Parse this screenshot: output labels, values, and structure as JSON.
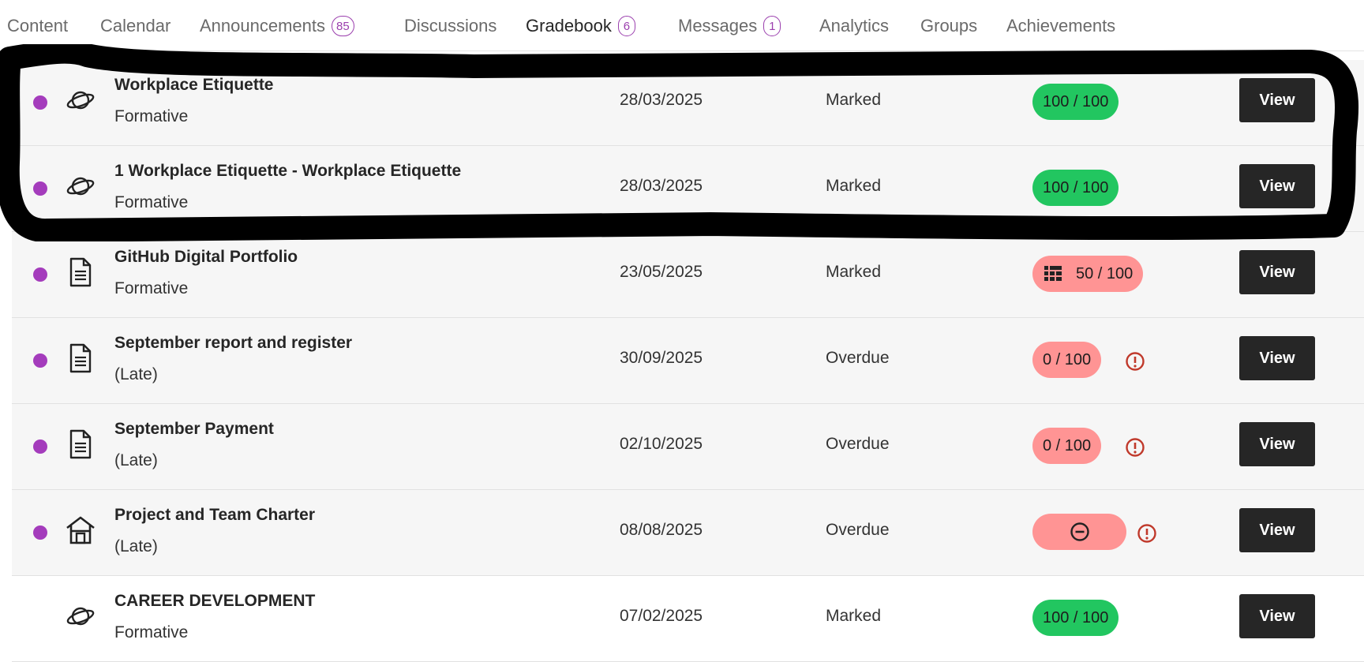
{
  "nav": {
    "tabs": [
      {
        "label": "Content"
      },
      {
        "label": "Calendar"
      },
      {
        "label": "Announcements",
        "badge": "85"
      },
      {
        "label": "Discussions"
      },
      {
        "label": "Gradebook",
        "badge": "6"
      },
      {
        "label": "Messages",
        "badge": "1"
      },
      {
        "label": "Analytics"
      },
      {
        "label": "Groups"
      },
      {
        "label": "Achievements"
      }
    ],
    "active_tab": "Gradebook"
  },
  "colors": {
    "accent": "#a43cbc",
    "grade_pass": "#22c660",
    "grade_fail": "#ff9494",
    "button": "#262626",
    "warning": "#c0392b"
  },
  "rows": [
    {
      "title": "Workplace Etiquette",
      "subtitle": "Formative",
      "date": "28/03/2025",
      "status": "Marked",
      "grade": "100 / 100",
      "icon": "planet-icon",
      "view": "View"
    },
    {
      "title": "1 Workplace Etiquette - Workplace Etiquette",
      "subtitle": "Formative",
      "date": "28/03/2025",
      "status": "Marked",
      "grade": "100 / 100",
      "icon": "planet-icon",
      "view": "View"
    },
    {
      "title": "GitHub Digital Portfolio",
      "subtitle": "Formative",
      "date": "23/05/2025",
      "status": "Marked",
      "grade": "50 / 100",
      "icon": "document-icon",
      "view": "View"
    },
    {
      "title": "September report and register",
      "subtitle": "(Late)",
      "date": "30/09/2025",
      "status": "Overdue",
      "grade": "0 / 100",
      "icon": "document-icon",
      "view": "View"
    },
    {
      "title": "September Payment",
      "subtitle": "(Late)",
      "date": "02/10/2025",
      "status": "Overdue",
      "grade": "0 / 100",
      "icon": "document-icon",
      "view": "View"
    },
    {
      "title": "Project and Team Charter",
      "subtitle": "(Late)",
      "date": "08/08/2025",
      "status": "Overdue",
      "grade": "",
      "icon": "home-icon",
      "view": "View"
    },
    {
      "title": "CAREER DEVELOPMENT",
      "subtitle": "Formative",
      "date": "07/02/2025",
      "status": "Marked",
      "grade": "100 / 100",
      "icon": "planet-icon",
      "view": "View"
    }
  ]
}
